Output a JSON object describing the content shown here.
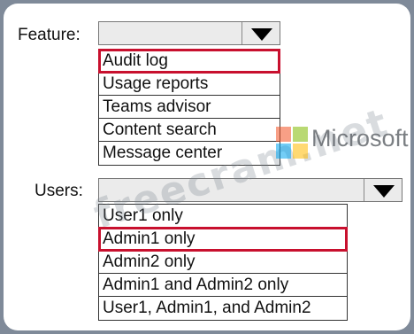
{
  "feature": {
    "label": "Feature:",
    "options": [
      "Audit log",
      "Usage reports",
      "Teams advisor",
      "Content search",
      "Message center"
    ],
    "selected_index": 0
  },
  "users": {
    "label": "Users:",
    "options": [
      "User1 only",
      "Admin1 only",
      "Admin2 only",
      "Admin1 and Admin2 only",
      "User1, Admin1, and Admin2"
    ],
    "selected_index": 1
  },
  "watermark": {
    "site": "freecram.net",
    "brand": "Microsoft"
  },
  "colors": {
    "frame": "#7f8a99",
    "selection_outline": "#c8102e",
    "dropdown_bg": "#ebebeb",
    "ms_red": "#f25022",
    "ms_green": "#7fba00",
    "ms_blue": "#00a4ef",
    "ms_yellow": "#ffb900"
  }
}
